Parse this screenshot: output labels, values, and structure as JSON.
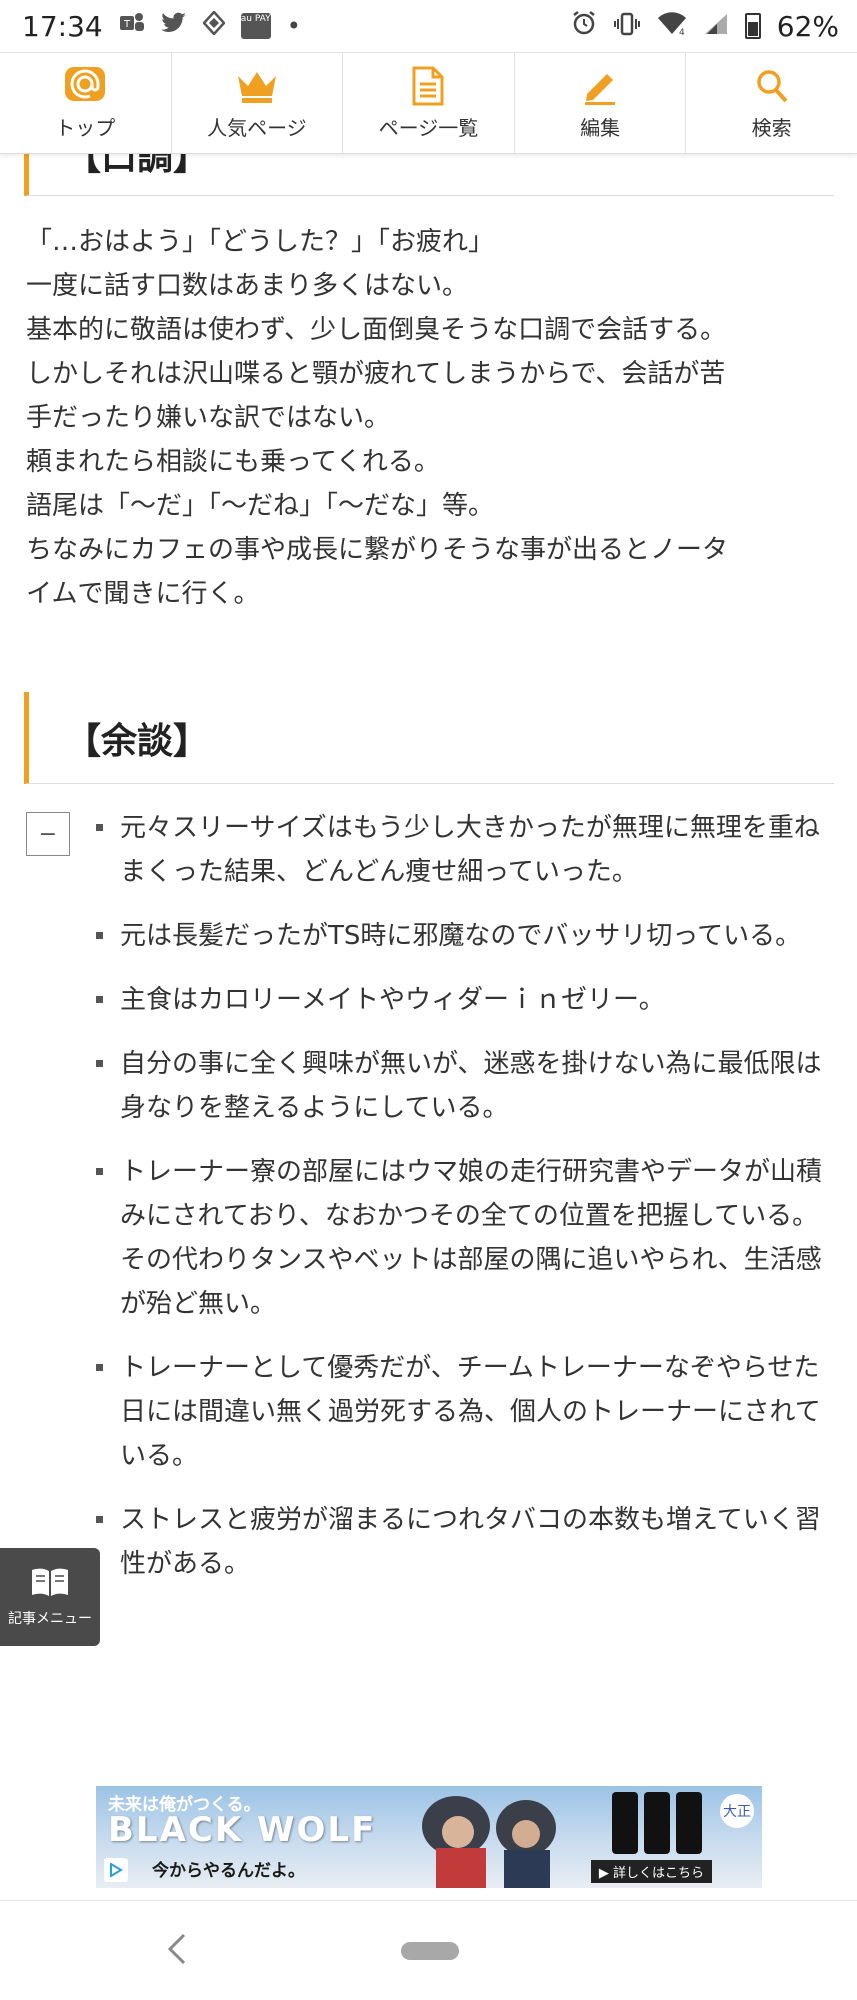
{
  "status_bar": {
    "time": "17:34",
    "battery": "62%",
    "battery_level": 0.62,
    "pay_chip": "au PAY",
    "left_icons": [
      "teams-icon",
      "twitter-icon",
      "diamond-icon",
      "au-pay-icon",
      "dot-icon"
    ],
    "right_icons": [
      "alarm-icon",
      "vibrate-icon",
      "wifi-icon",
      "signal-icon",
      "battery-icon"
    ]
  },
  "nav": {
    "items": [
      {
        "label": "トップ",
        "icon": "at-icon"
      },
      {
        "label": "人気ページ",
        "icon": "crown-icon"
      },
      {
        "label": "ページ一覧",
        "icon": "document-icon"
      },
      {
        "label": "編集",
        "icon": "pencil-icon"
      },
      {
        "label": "検索",
        "icon": "search-icon"
      }
    ],
    "accent_color": "#f0a020"
  },
  "tone_section": {
    "heading": "【口調】",
    "lines": [
      "「…おはよう」「どうした？」「お疲れ」",
      "一度に話す口数はあまり多くはない。",
      "基本的に敬語は使わず、少し面倒臭そうな口調で会話する。",
      "しかしそれは沢山喋ると顎が疲れてしまうからで、会話が苦",
      "手だったり嫌いな訳ではない。",
      "頼まれたら相談にも乗ってくれる。",
      "語尾は「〜だ」「〜だね」「〜だな」等。",
      "ちなみにカフェの事や成長に繋がりそうな事が出るとノータ",
      "イムで聞きに行く。"
    ]
  },
  "trivia_section": {
    "heading": "【余談】",
    "toggle": "−",
    "items": [
      "元々スリーサイズはもう少し大きかったが無理に無理を重ねまくった結果、どんどん痩せ細っていった。",
      "元は長髪だったがTS時に邪魔なのでバッサリ切っている。",
      "主食はカロリーメイトやウィダーｉｎゼリー。",
      "自分の事に全く興味が無いが、迷惑を掛けない為に最低限は身なりを整えるようにしている。",
      "トレーナー寮の部屋にはウマ娘の走行研究書やデータが山積みにされており、なおかつその全ての位置を把握している。その代わりタンスやベットは部屋の隅に追いやられ、生活感が殆ど無い。",
      "トレーナーとして優秀だが、チームトレーナーなぞやらせた日には間違い無く過労死する為、個人のトレーナーにされている。",
      "ストレスと疲労が溜まるにつれタバコの本数も増えていく習性がある。"
    ]
  },
  "side_menu": {
    "label": "記事メニュー",
    "icon": "book-icon"
  },
  "next_heading": {
    "text": "【"
  },
  "ad": {
    "slogan": "未来は俺がつくる。",
    "brand": "BLACK WOLF",
    "sub": "今からやるんだよ。",
    "cta": "▶ 詳しくはこちら",
    "logo": "大正"
  },
  "system_nav": {
    "back_icon": "back-icon",
    "home_icon": "home-pill-icon"
  }
}
